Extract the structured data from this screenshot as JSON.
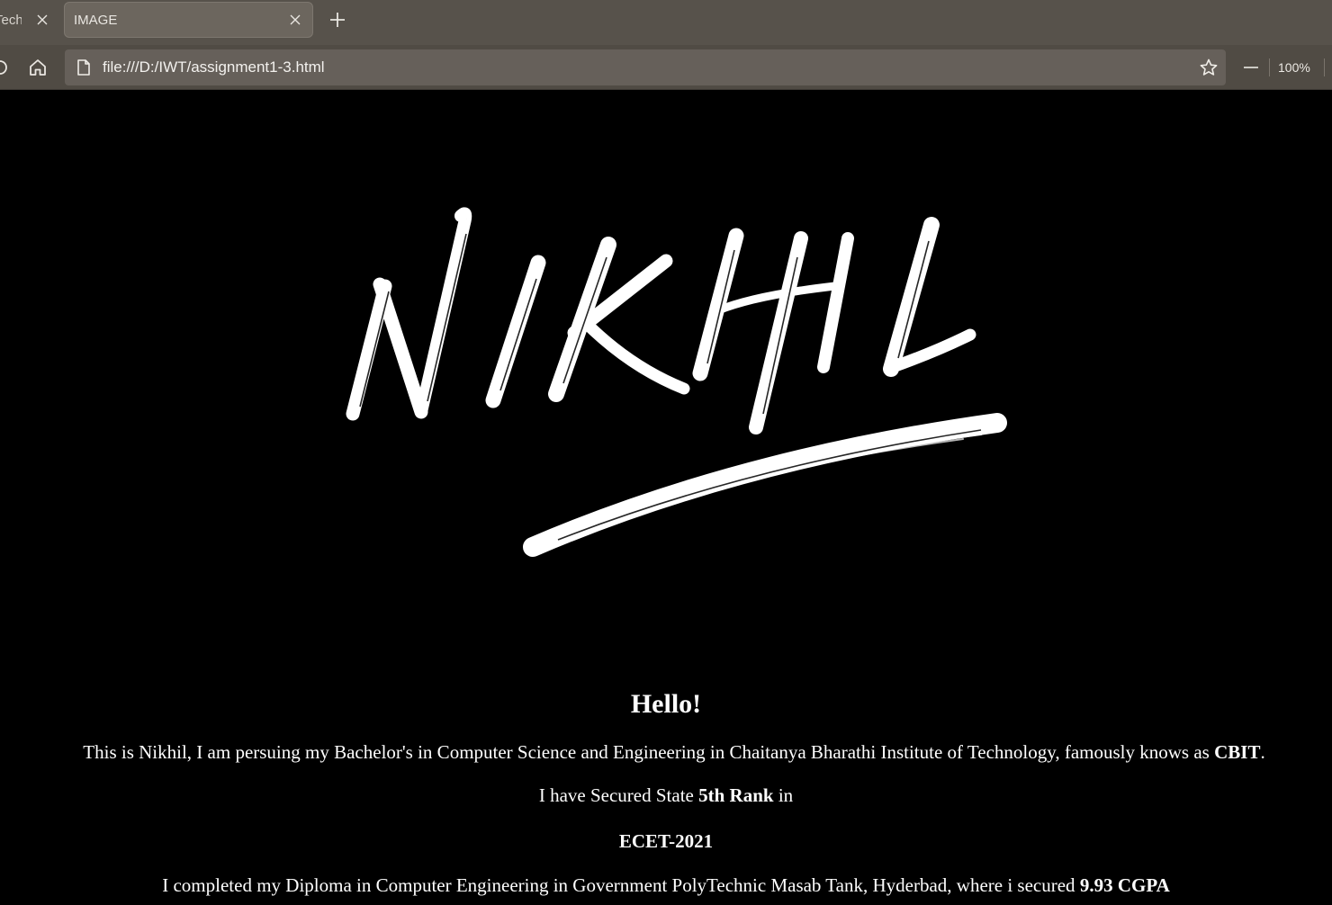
{
  "browser": {
    "tabs": [
      {
        "label": "Technologies",
        "active": false
      },
      {
        "label": "IMAGE",
        "active": true
      }
    ],
    "address": "file:///D:/IWT/assignment1-3.html",
    "zoom": "100%"
  },
  "page": {
    "logo_text": "NIKHIL",
    "greeting": "Hello!",
    "intro": {
      "text": "This is Nikhil, I am persuing my Bachelor's in Computer Science and Engineering in Chaitanya Bharathi Institute of Technology, famously knows as ",
      "emphasis": "CBIT",
      "suffix": "."
    },
    "rank": {
      "prefix": "I have Secured State ",
      "emphasis": "5th Rank",
      "suffix": " in"
    },
    "exam": "ECET-2021",
    "diploma": {
      "text": "I completed my Diploma in Computer Engineering in Government PolyTechnic Masab Tank, Hyderbad, where i secured ",
      "emphasis": "9.93 CGPA"
    }
  },
  "colors": {
    "tabbar": "#57524b",
    "toolbar": "#504b44",
    "address_bar": "#66605a",
    "page_background": "#000000",
    "page_text": "#ffffff"
  }
}
